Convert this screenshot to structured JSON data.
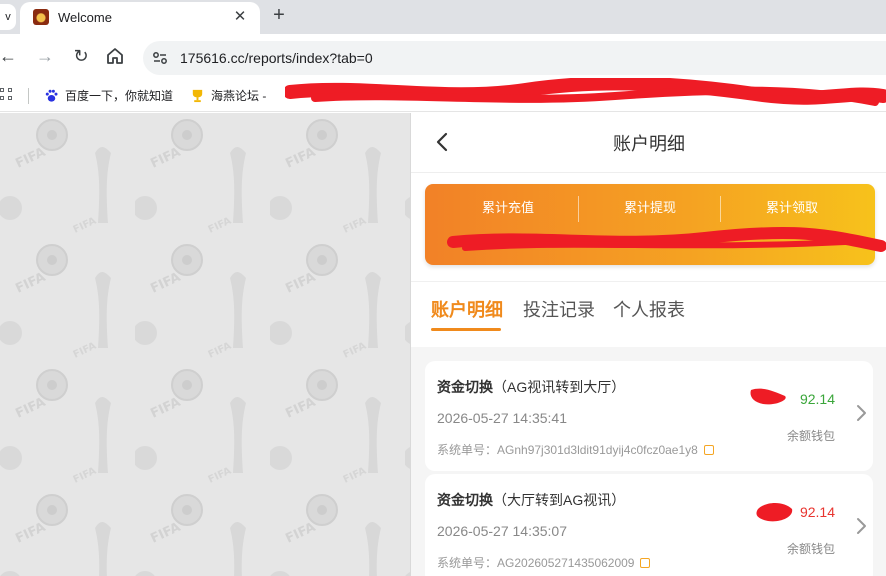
{
  "browser": {
    "tab_title": "Welcome",
    "tab_close": "✕",
    "new_tab": "+",
    "tab_menu": "v",
    "url": "175616.cc/reports/index?tab=0",
    "nav": {
      "back": "←",
      "forward": "→",
      "reload": "↻"
    }
  },
  "bookmarks": [
    {
      "label": "百度一下，你就知道",
      "icon": "baidu-paw-icon"
    },
    {
      "label": "海燕论坛 -",
      "icon": "trophy-icon"
    }
  ],
  "header": {
    "title": "账户明细",
    "back_icon": "chevron-left-icon"
  },
  "summary": {
    "labels": [
      "累计充值",
      "累计提现",
      "累计领取"
    ],
    "color_start": "#f28127",
    "color_end": "#f7c21b"
  },
  "tabs": [
    {
      "label": "账户明细",
      "active": true
    },
    {
      "label": "投注记录",
      "active": false
    },
    {
      "label": "个人报表",
      "active": false
    }
  ],
  "accent_color": "#f08a1c",
  "records": [
    {
      "type": "资金切换",
      "detail": "（AG视讯转到大厅）",
      "datetime": "2026-05-27 14:35:41",
      "order_label": "系统单号：",
      "order_no": "AGnh97j301d3ldit91dyij4c0fcz0ae1y8",
      "amount": "92.14",
      "amount_color": "#3aa63a",
      "wallet": "余额钱包"
    },
    {
      "type": "资金切换",
      "detail": "（大厅转到AG视讯）",
      "datetime": "2026-05-27 14:35:07",
      "order_label": "系统单号：",
      "order_no": "AG202605271435062009",
      "amount": "92.14",
      "amount_color": "#e8342f",
      "wallet": "余额钱包"
    }
  ]
}
